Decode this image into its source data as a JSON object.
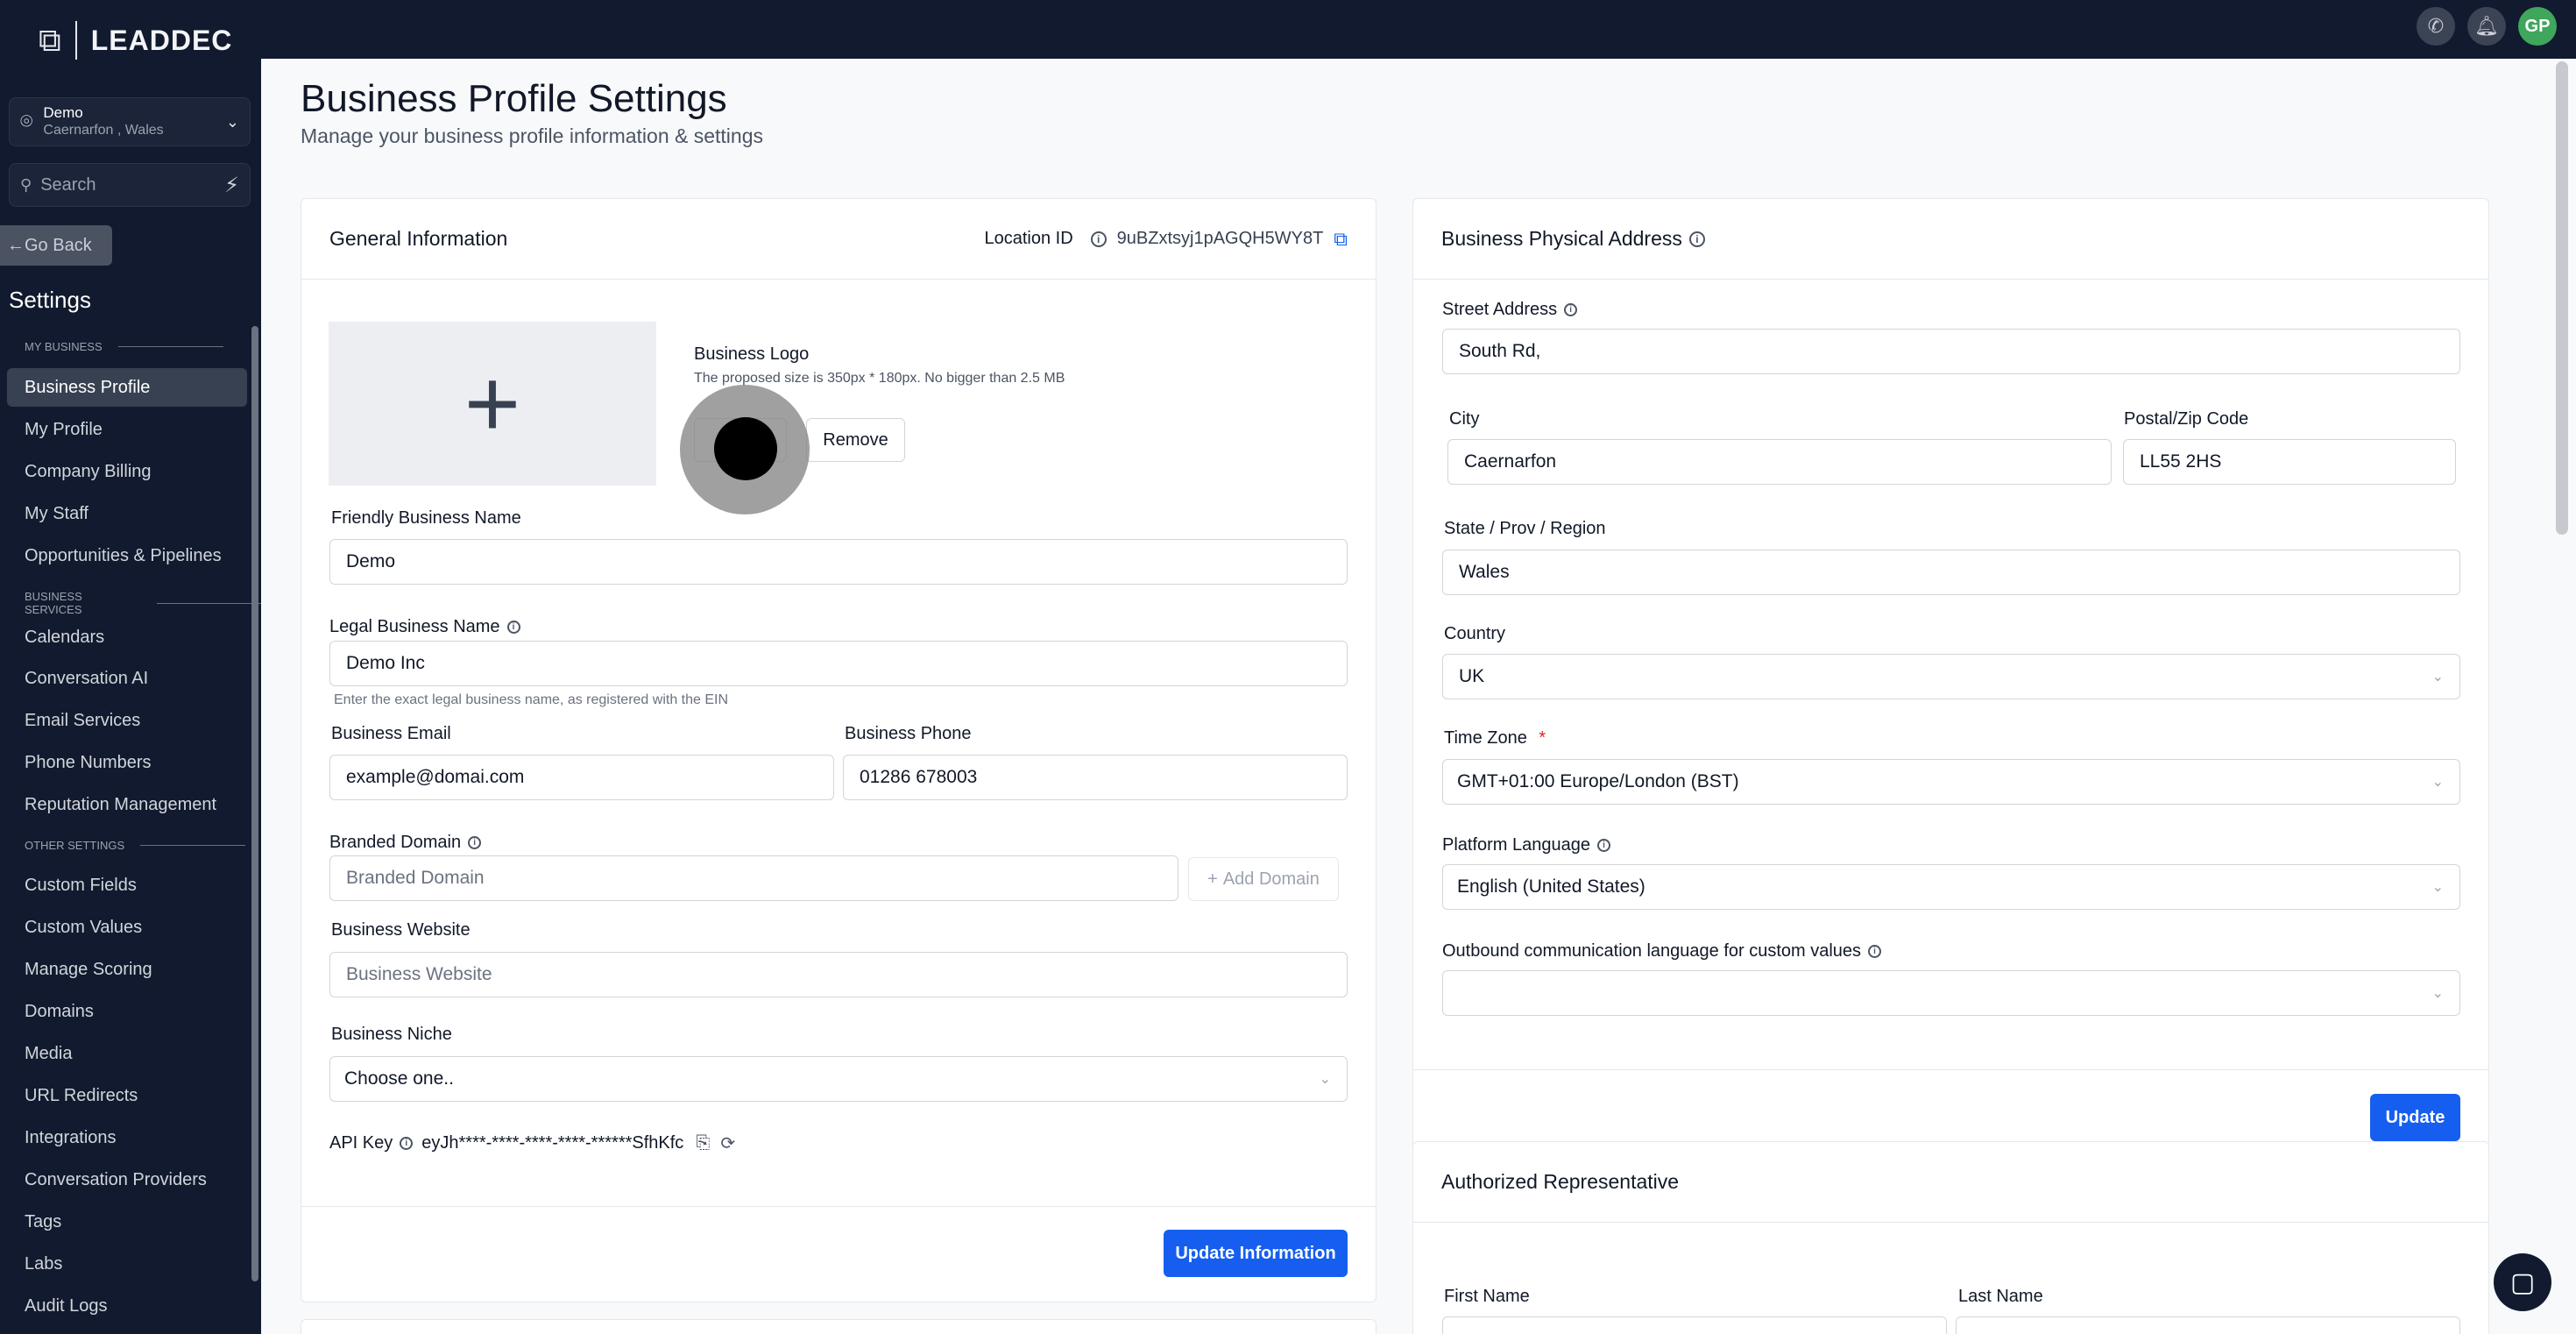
{
  "app": {
    "brand": "LEADDEC"
  },
  "topbar": {
    "avatar_initials": "GP"
  },
  "sidebar": {
    "location_name": "Demo",
    "location_sub": "Caernarfon , Wales",
    "search_placeholder": "Search",
    "go_back": "Go Back",
    "settings_title": "Settings",
    "sections": {
      "my_business": "MY BUSINESS",
      "business_services": "BUSINESS SERVICES",
      "other_settings": "OTHER SETTINGS"
    },
    "items": [
      "Business Profile",
      "My Profile",
      "Company Billing",
      "My Staff",
      "Opportunities & Pipelines",
      "Calendars",
      "Conversation AI",
      "Email Services",
      "Phone Numbers",
      "Reputation Management",
      "Custom Fields",
      "Custom Values",
      "Manage Scoring",
      "Domains",
      "Media",
      "URL Redirects",
      "Integrations",
      "Conversation Providers",
      "Tags",
      "Labs",
      "Audit Logs"
    ]
  },
  "page": {
    "title": "Business Profile Settings",
    "subtitle": "Manage your business profile information & settings"
  },
  "general": {
    "title": "General Information",
    "location_id_label": "Location ID",
    "location_id": "9uBZxtsyj1pAGQH5WY8T",
    "logo_label": "Business Logo",
    "logo_hint": "The proposed size is 350px * 180px. No bigger than 2.5 MB",
    "remove": "Remove",
    "friendly_name_label": "Friendly Business Name",
    "friendly_name": "Demo",
    "legal_name_label": "Legal Business Name",
    "legal_name": "Demo Inc",
    "legal_hint": "Enter the exact legal business name, as registered with the EIN",
    "email_label": "Business Email",
    "email": "example@domai.com",
    "phone_label": "Business Phone",
    "phone": "01286 678003",
    "domain_label": "Branded Domain",
    "domain_placeholder": "Branded Domain",
    "add_domain": "Add Domain",
    "website_label": "Business Website",
    "website_placeholder": "Business Website",
    "niche_label": "Business Niche",
    "niche_value": "Choose one..",
    "api_key_label": "API Key",
    "api_key": "eyJh****-****-****-****-******SfhKfc",
    "update": "Update Information"
  },
  "address": {
    "title": "Business Physical Address",
    "street_label": "Street Address",
    "street": "South Rd,",
    "city_label": "City",
    "city": "Caernarfon",
    "postal_label": "Postal/Zip Code",
    "postal": "LL55 2HS",
    "state_label": "State / Prov / Region",
    "state": "Wales",
    "country_label": "Country",
    "country": "UK",
    "tz_label": "Time Zone",
    "tz_required": "*",
    "tz": "GMT+01:00 Europe/London (BST)",
    "lang_label": "Platform Language",
    "lang": "English (United States)",
    "outbound_label": "Outbound communication language for custom values",
    "outbound": "",
    "update": "Update"
  },
  "rep": {
    "title": "Authorized Representative",
    "first_name_label": "First Name",
    "last_name_label": "Last Name"
  }
}
